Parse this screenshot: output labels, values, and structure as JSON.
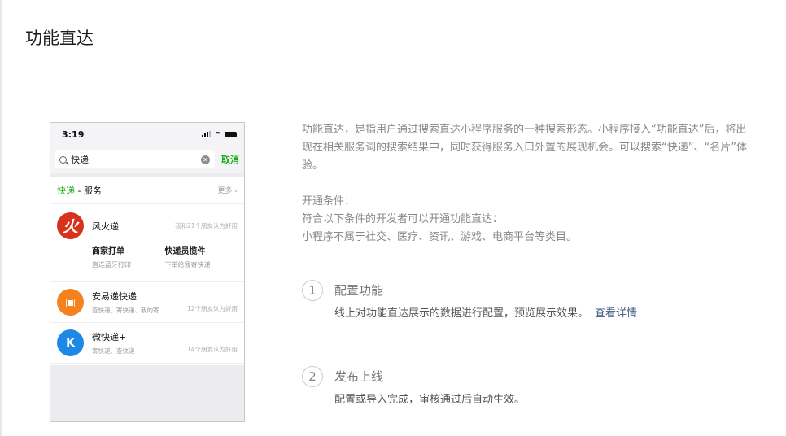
{
  "page": {
    "title": "功能直达"
  },
  "phone": {
    "time": "3:19",
    "search": {
      "query": "快递",
      "cancel": "取消"
    },
    "section": {
      "keyword": "快递",
      "suffix": " - 服务",
      "more": "更多 ›"
    },
    "service": {
      "name": "风火递",
      "logo_char": "火",
      "meta": "我和21个朋友认为好用",
      "actions": [
        {
          "title": "商家打单",
          "desc": "直连蓝牙打印"
        },
        {
          "title": "快递员揽件",
          "desc": "下单给我寄快递"
        }
      ]
    },
    "items": [
      {
        "name": "安易递快递",
        "desc": "查快递、寄快递、我的寄...",
        "meta": "12个朋友认为好用",
        "icon": "box-icon"
      },
      {
        "name": "微快递+",
        "desc": "寄快递、查快递",
        "meta": "14个朋友认为好用",
        "icon": "k-icon"
      }
    ]
  },
  "intro": "功能直达，是指用户通过搜索直达小程序服务的一种搜索形态。小程序接入“功能直达”后，将出现在相关服务词的搜索结果中，同时获得服务入口外置的展现机会。可以搜索“快递”、“名片”体验。",
  "conditions": {
    "heading": "开通条件：",
    "line1": "符合以下条件的开发者可以开通功能直达：",
    "line2": "小程序不属于社交、医疗、资讯、游戏、电商平台等类目。"
  },
  "steps": [
    {
      "num": "1",
      "title": "配置功能",
      "desc": "线上对功能直达展示的数据进行配置，预览展示效果。",
      "link": "查看详情"
    },
    {
      "num": "2",
      "title": "发布上线",
      "desc": "配置或导入完成，审核通过后自动生效。"
    }
  ]
}
